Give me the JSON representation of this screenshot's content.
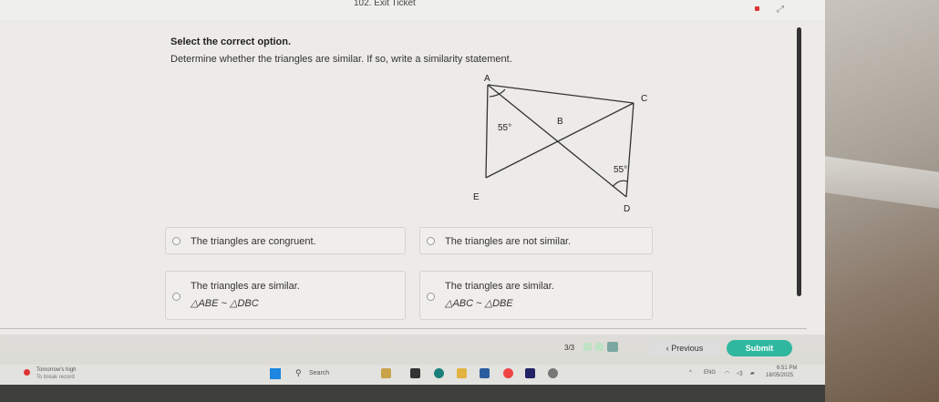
{
  "window": {
    "title": "102. Exit Ticket"
  },
  "question": {
    "heading": "Select the correct option.",
    "prompt": "Determine whether the triangles are similar. If so, write a similarity statement."
  },
  "diagram": {
    "labels": {
      "A": "A",
      "B": "B",
      "C": "C",
      "D": "D",
      "E": "E"
    },
    "angle_A": "55°",
    "angle_D": "55°"
  },
  "options": [
    {
      "text": "The triangles are congruent.",
      "statement": ""
    },
    {
      "text": "The triangles are not similar.",
      "statement": ""
    },
    {
      "text": "The triangles are similar.",
      "statement": "△ABE ~ △DBC"
    },
    {
      "text": "The triangles are similar.",
      "statement": "△ABC ~ △DBE"
    }
  ],
  "navigation": {
    "progress": "3/3",
    "previous_label": "Previous",
    "submit_label": "Submit"
  },
  "taskbar": {
    "weather_line1": "Tomorrow's high",
    "weather_line2": "To break record",
    "search_label": "Search",
    "lang": "ENG",
    "time": "6:51 PM",
    "date": "18/05/2025"
  }
}
